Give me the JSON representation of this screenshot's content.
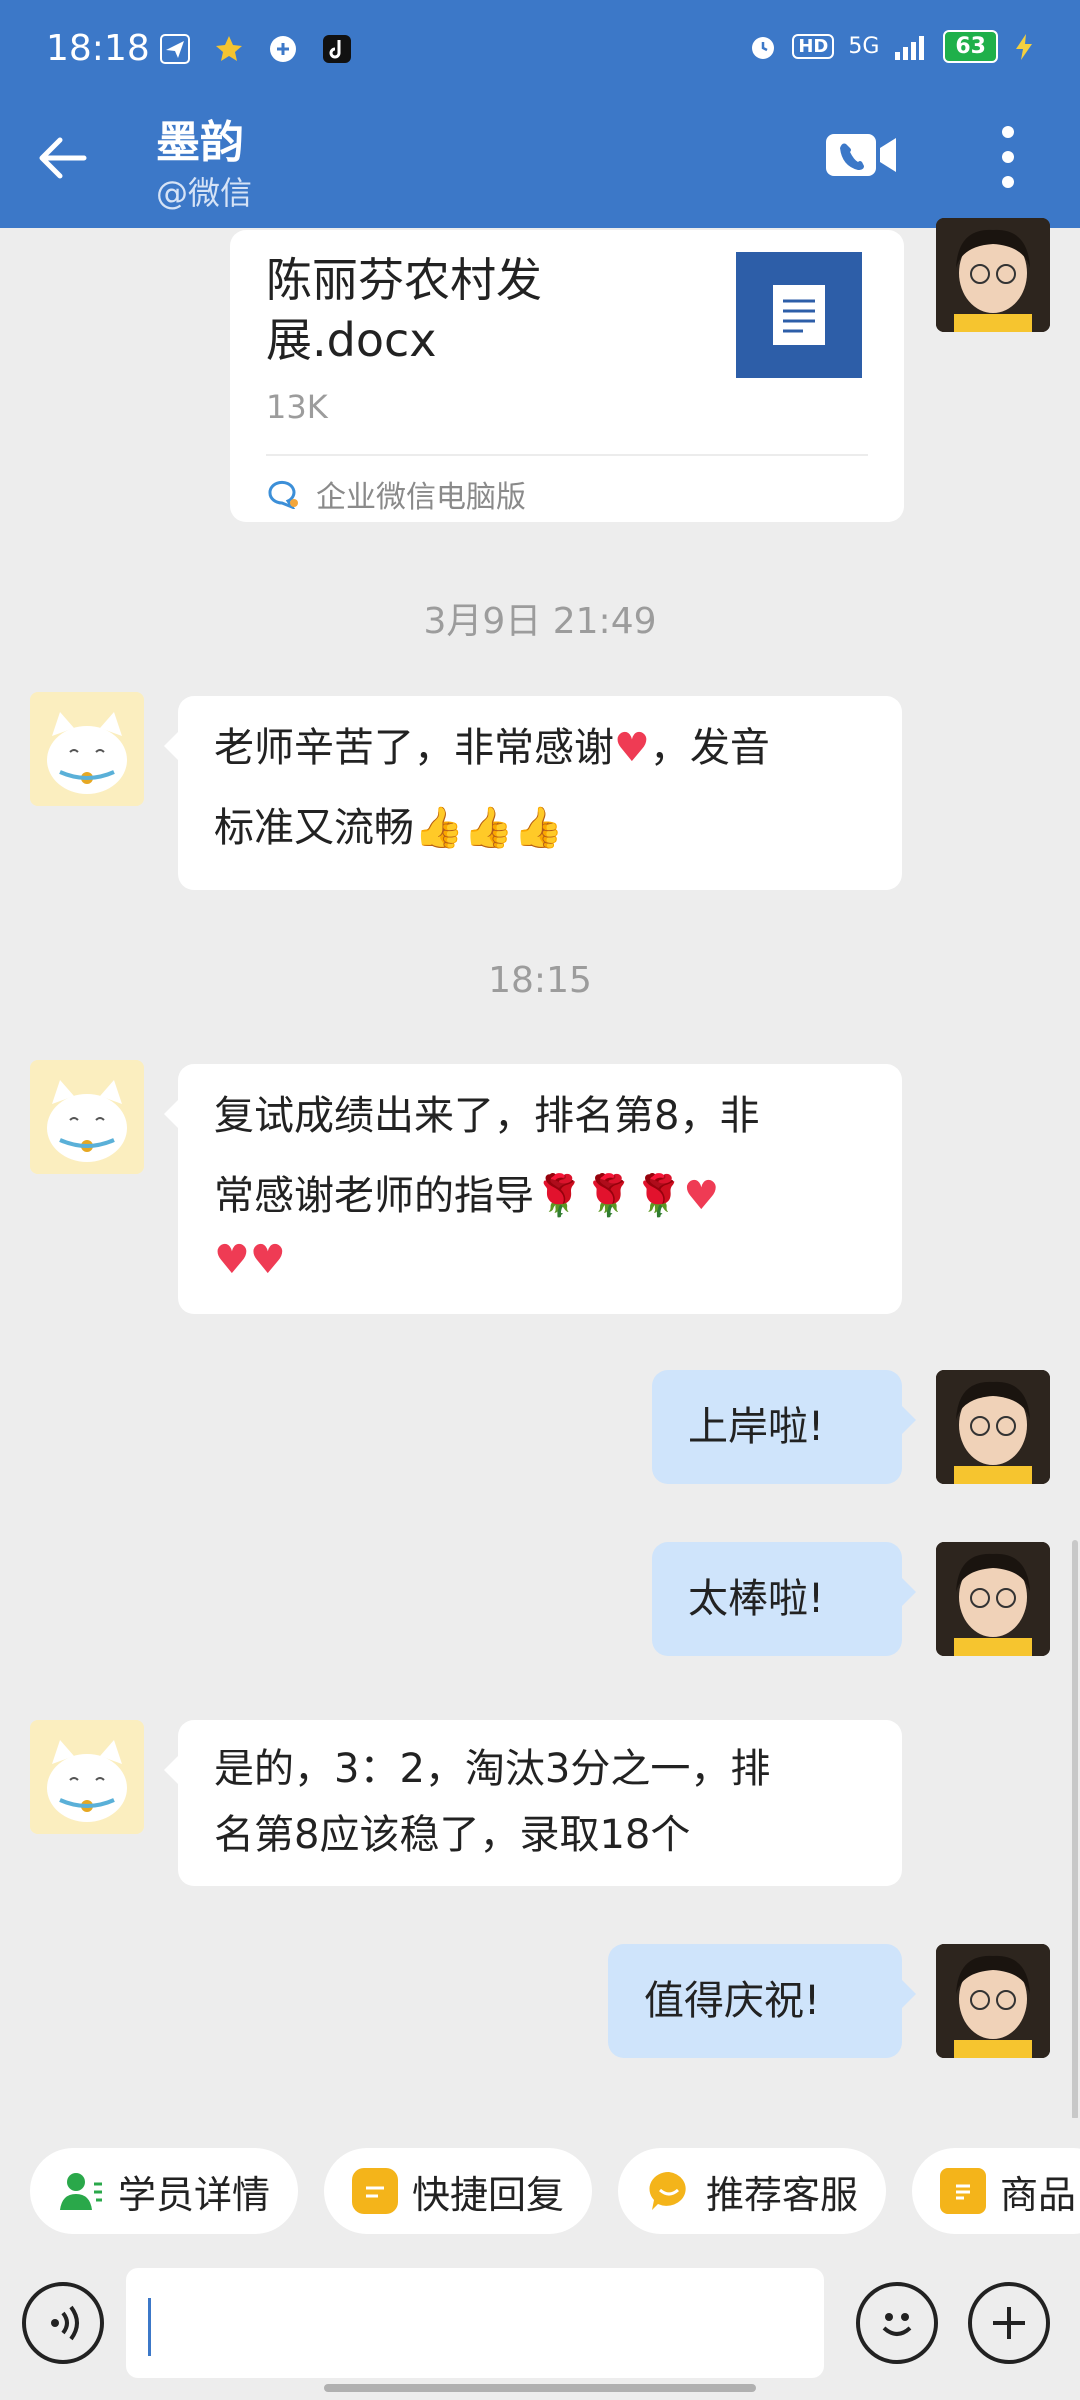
{
  "status_bar": {
    "time": "18:18",
    "signal": "5G",
    "hd": "HD",
    "battery": "63"
  },
  "header": {
    "title": "墨韵",
    "subtitle": "@微信"
  },
  "file_message": {
    "file_name": "陈丽芬农村发展.docx",
    "file_size": "13K",
    "source": "企业微信电脑版"
  },
  "timestamps": {
    "t1": "3月9日  21:49",
    "t2": "18:15"
  },
  "messages": {
    "m1_text": "老师辛苦了，非常感谢",
    "m1_text2": "，发音",
    "m1_line2": "标准又流畅",
    "m2_line1": "复试成绩出来了，排名第8，非",
    "m2_line2": "常感谢老师的指导",
    "m3": "上岸啦!",
    "m4": "太棒啦!",
    "m5_line1": "是的，3：2，淘汰3分之一，排",
    "m5_line2": "名第8应该稳了，录取18个",
    "m6": "值得庆祝!"
  },
  "quick_actions": {
    "student": "学员详情",
    "reply": "快捷回复",
    "service": "推荐客服",
    "goods": "商品"
  },
  "input": {
    "placeholder": ""
  },
  "colors": {
    "header": "#3c78c8",
    "self_bubble": "#cfe4fb",
    "background": "#ededed"
  }
}
